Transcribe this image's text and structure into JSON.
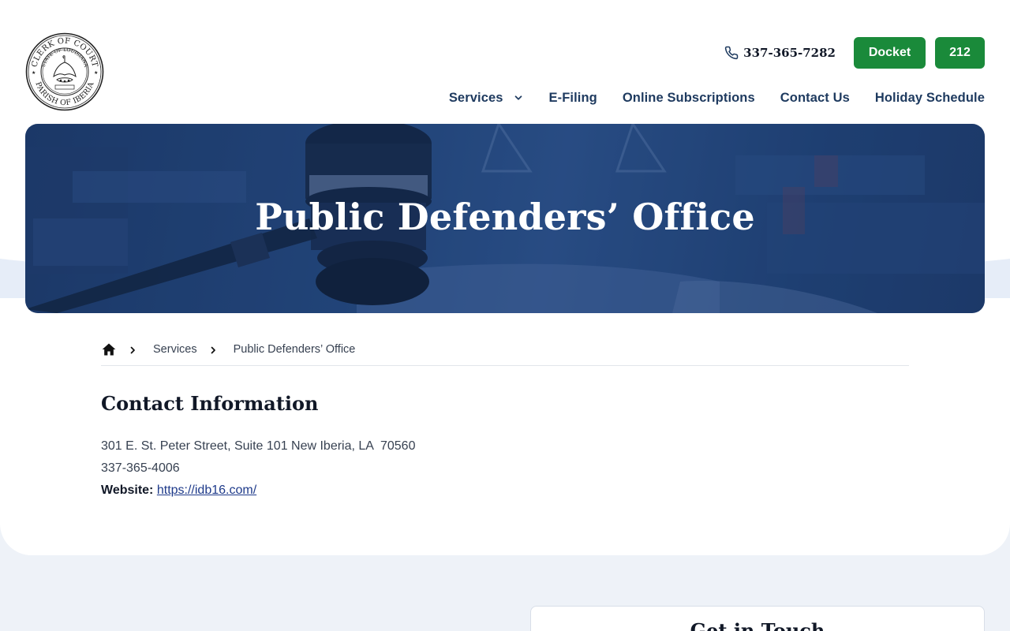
{
  "header": {
    "logo": {
      "alt": "Clerk of Court, State of Louisiana, Parish of Iberia seal",
      "ring_top": "CLERK OF COURT",
      "ring_bottom": "PARISH OF IBERIA",
      "inner_ring": "STATE OF LOUISIANA",
      "motto": "UNION · JUSTICE · CONFIDENCE"
    },
    "phone": "337-365-7282",
    "buttons": {
      "docket": "Docket",
      "n212": "212"
    },
    "accent_color": "#1a8a3a"
  },
  "nav": {
    "items": [
      {
        "label": "Services",
        "has_dropdown": true
      },
      {
        "label": "E-Filing"
      },
      {
        "label": "Online Subscriptions"
      },
      {
        "label": "Contact Us"
      },
      {
        "label": "Holiday Schedule"
      }
    ]
  },
  "hero": {
    "title": "Public Defenders’ Office",
    "background_color": "#1e3f72"
  },
  "breadcrumb": {
    "items": [
      "Services",
      "Public Defenders’ Office"
    ]
  },
  "contact": {
    "heading": "Contact Information",
    "address": "301 E. St. Peter Street, Suite 101 New Iberia, LA  70560",
    "phone": "337-365-4006",
    "website_label": "Website:",
    "website_url": "https://idb16.com/"
  },
  "footer_card": {
    "title": "Get in Touch"
  }
}
